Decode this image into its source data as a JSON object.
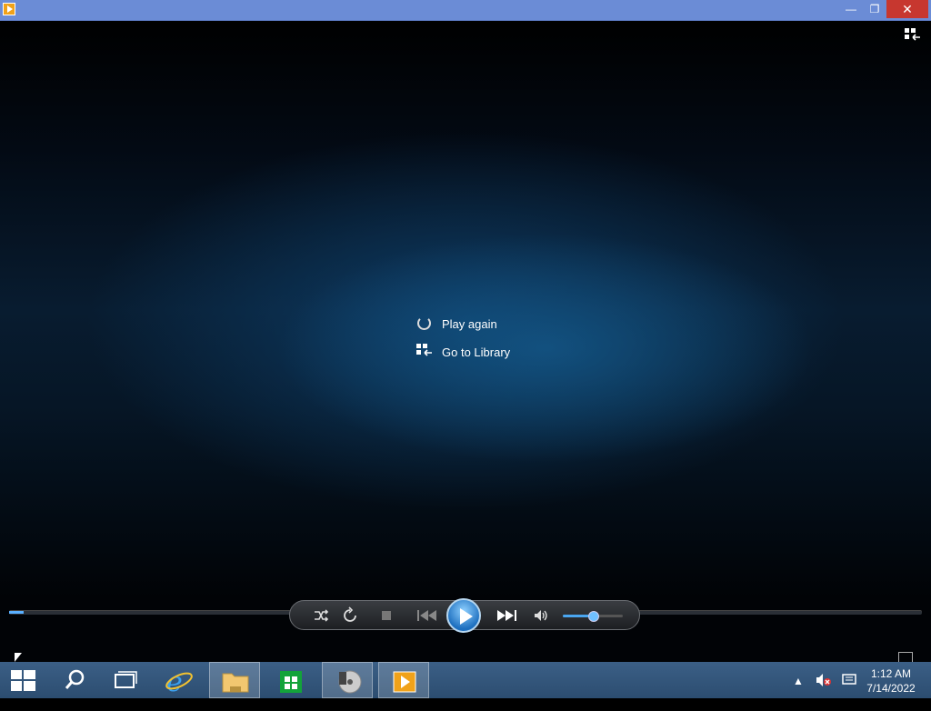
{
  "titlebar": {
    "minimize": "—",
    "restore": "❐",
    "close": "✕"
  },
  "overlay_menu": {
    "play_again": "Play again",
    "go_to_library": "Go to Library"
  },
  "playback": {
    "progress": 0.016,
    "volume": 0.5
  },
  "taskbar": {
    "time": "1:12 AM",
    "date": "7/14/2022",
    "tray_up_arrow": "▲"
  },
  "colors": {
    "accent": "#4aa6f0",
    "close": "#c7372f",
    "taskbar": "#2c4d70"
  }
}
